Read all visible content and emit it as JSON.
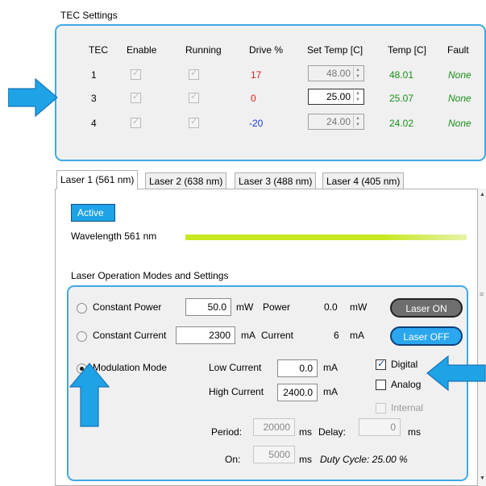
{
  "tec": {
    "group_title": "TEC Settings",
    "headers": [
      "TEC",
      "Enable",
      "Running",
      "Drive %",
      "Set Temp [C]",
      "Temp [C]",
      "Fault"
    ],
    "rows": [
      {
        "tec": "1",
        "drive": "17",
        "drive_color": "#e02020",
        "set_temp": "48.00",
        "temp": "48.01",
        "fault": "None"
      },
      {
        "tec": "3",
        "drive": "0",
        "drive_color": "#e02020",
        "set_temp": "25.00",
        "temp": "25.07",
        "fault": "None"
      },
      {
        "tec": "4",
        "drive": "-20",
        "drive_color": "#1a3ad6",
        "set_temp": "24.00",
        "temp": "24.02",
        "fault": "None"
      }
    ],
    "temp_color": "#1a8f1a",
    "fault_color": "#1a8f1a"
  },
  "tabs": [
    "Laser 1 (561 nm)",
    "Laser 2 (638 nm)",
    "Laser 3 (488 nm)",
    "Laser 4 (405 nm)"
  ],
  "laser": {
    "status_label": "Active",
    "wavelength_label": "Wavelength 561 nm",
    "wavelength_color": "#c8e820"
  },
  "modes": {
    "group_title": "Laser Operation Modes and Settings",
    "constant_power": {
      "label": "Constant Power",
      "value": "50.0",
      "unit": "mW",
      "readout_label": "Power",
      "readout_value": "0.0",
      "readout_unit": "mW"
    },
    "constant_current": {
      "label": "Constant Current",
      "value": "2300",
      "unit": "mA",
      "readout_label": "Current",
      "readout_value": "6",
      "readout_unit": "mA"
    },
    "modulation": {
      "label": "Modulation Mode",
      "low_label": "Low Current",
      "low_value": "0.0",
      "low_unit": "mA",
      "high_label": "High Current",
      "high_value": "2400.0",
      "high_unit": "mA",
      "digital": "Digital",
      "analog": "Analog",
      "internal": "Internal",
      "period_label": "Period:",
      "period_value": "20000",
      "period_unit": "ms",
      "delay_label": "Delay:",
      "delay_value": "0",
      "delay_unit": "ms",
      "on_label": "On:",
      "on_value": "5000",
      "on_unit": "ms",
      "duty_cycle": "Duty Cycle: 25.00 %"
    },
    "laser_on": "Laser ON",
    "laser_off": "Laser OFF"
  },
  "colors": {
    "accent": "#3fa9e5",
    "active_blue": "#1ea3e6",
    "laser_on_gray": "#6e6e6e",
    "laser_off_blue": "#2aa7ee"
  }
}
